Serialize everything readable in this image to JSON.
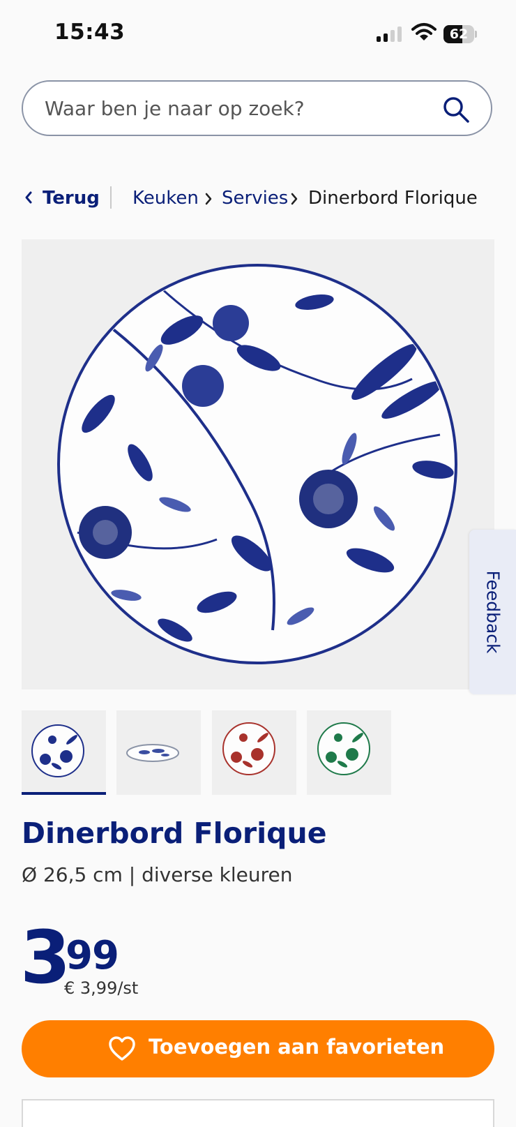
{
  "status_bar": {
    "time": "15:43",
    "battery": "62",
    "battery_level": 0.62,
    "signal_bars_active": 2,
    "signal_bars_total": 4
  },
  "search": {
    "placeholder": "Waar ben je naar op zoek?",
    "icon": "search-icon"
  },
  "breadcrumb": {
    "back_label": "Terug",
    "items": [
      "Keuken",
      "Servies",
      "Dinerbord Florique"
    ]
  },
  "gallery": {
    "thumbnails": [
      {
        "name": "thumb-blue-top",
        "selected": true
      },
      {
        "name": "thumb-blue-side",
        "selected": false
      },
      {
        "name": "thumb-red",
        "selected": false
      },
      {
        "name": "thumb-green",
        "selected": false
      }
    ]
  },
  "feedback": {
    "label": "Feedback"
  },
  "product": {
    "title": "Dinerbord Florique",
    "subtitle": "Ø 26,5 cm | diverse kleuren",
    "price_whole": "3",
    "price_cents": "99",
    "unit_price": "€ 3,99/st"
  },
  "actions": {
    "favorite_label": "Toevoegen aan favorieten",
    "favorite_icon": "heart-icon"
  },
  "colors": {
    "brand_blue": "#0a1f78",
    "accent_orange": "#ff7f00",
    "plate_blue": "#1e2f8a",
    "plate_red": "#a8322c",
    "plate_green": "#1f7a4a"
  }
}
